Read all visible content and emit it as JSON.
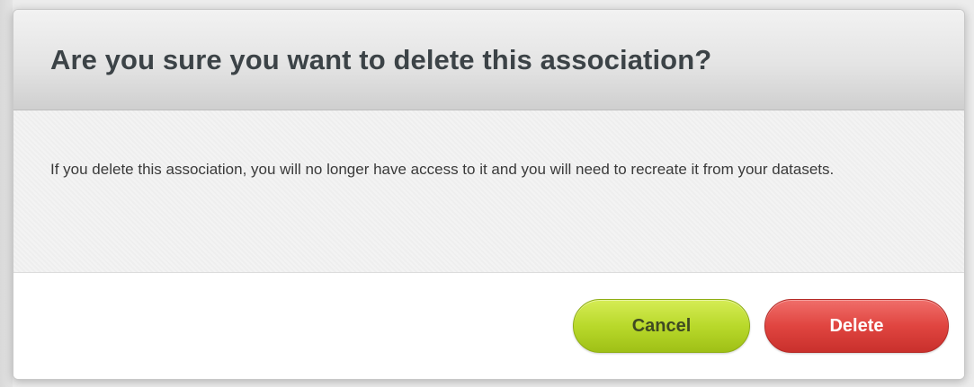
{
  "dialog": {
    "title": "Are you sure you want to delete this association?",
    "message": "If you delete this association, you will no longer have access to it and you will need to recreate it from your datasets.",
    "buttons": {
      "cancel_label": "Cancel",
      "delete_label": "Delete"
    }
  },
  "colors": {
    "cancel_button": "#b9d92b",
    "delete_button": "#e04540",
    "title_text": "#3c4347"
  }
}
